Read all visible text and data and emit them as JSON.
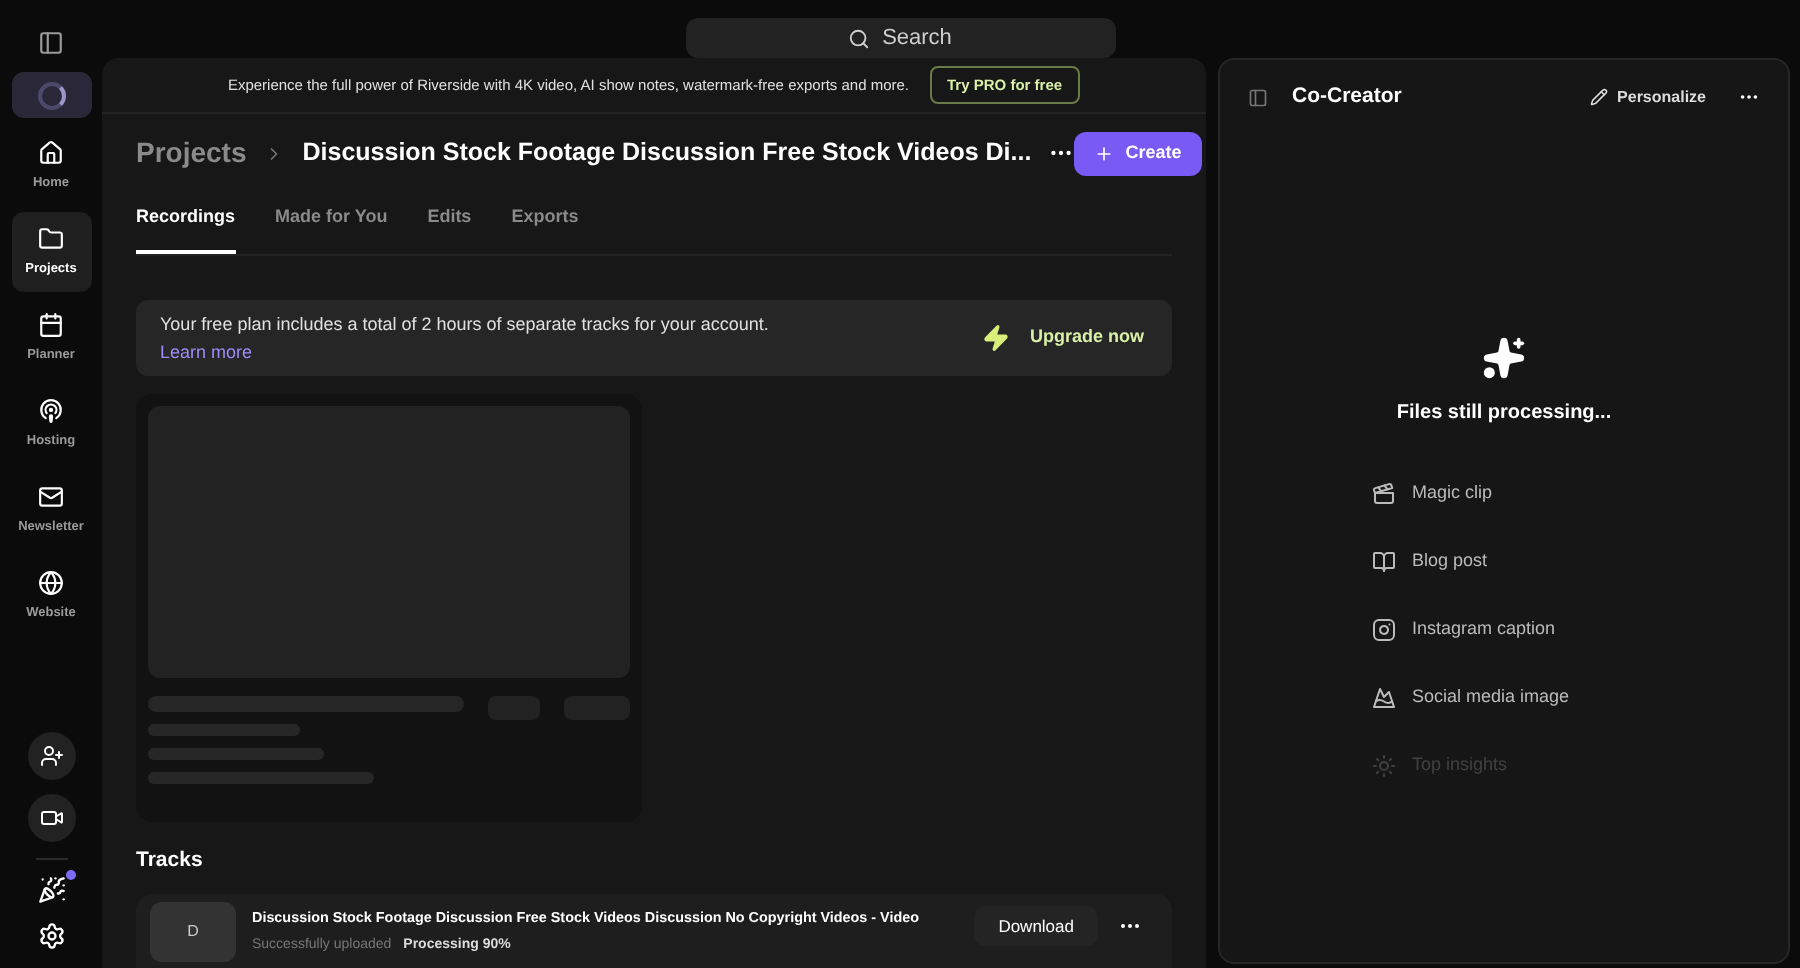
{
  "search": {
    "placeholder": "Search"
  },
  "sidebar": {
    "items": [
      {
        "label": "Home",
        "selected": false
      },
      {
        "label": "Projects",
        "selected": true
      },
      {
        "label": "Planner",
        "selected": false
      },
      {
        "label": "Hosting",
        "selected": false
      },
      {
        "label": "Newsletter",
        "selected": false
      },
      {
        "label": "Website",
        "selected": false
      }
    ]
  },
  "promo_banner": {
    "text": "Experience the full power of Riverside with 4K video, AI show notes, watermark-free exports and more.",
    "button": "Try PRO for free"
  },
  "breadcrumb": {
    "parent": "Projects",
    "title": "Discussion Stock Footage Discussion Free Stock Videos Di..."
  },
  "create_button": "Create",
  "tabs": [
    {
      "label": "Recordings",
      "selected": true
    },
    {
      "label": "Made for You",
      "selected": false
    },
    {
      "label": "Edits",
      "selected": false
    },
    {
      "label": "Exports",
      "selected": false
    }
  ],
  "plan_notice": {
    "text": "Your free plan includes a total of 2 hours of separate tracks for your account.",
    "link": "Learn more",
    "button": "Upgrade now"
  },
  "tracks": {
    "title": "Tracks",
    "items": [
      {
        "initial": "D",
        "name": "Discussion Stock Footage Discussion Free Stock Videos Discussion No Copyright Videos - Video",
        "status": "Successfully uploaded",
        "progress": "Processing 90%",
        "button": "Download"
      }
    ]
  },
  "co_creator": {
    "title": "Co-Creator",
    "personalize": "Personalize",
    "status": "Files still processing...",
    "items": [
      {
        "label": "Magic clip",
        "faded": false
      },
      {
        "label": "Blog post",
        "faded": false
      },
      {
        "label": "Instagram caption",
        "faded": false
      },
      {
        "label": "Social media image",
        "faded": false
      },
      {
        "label": "Top insights",
        "faded": true
      }
    ]
  }
}
